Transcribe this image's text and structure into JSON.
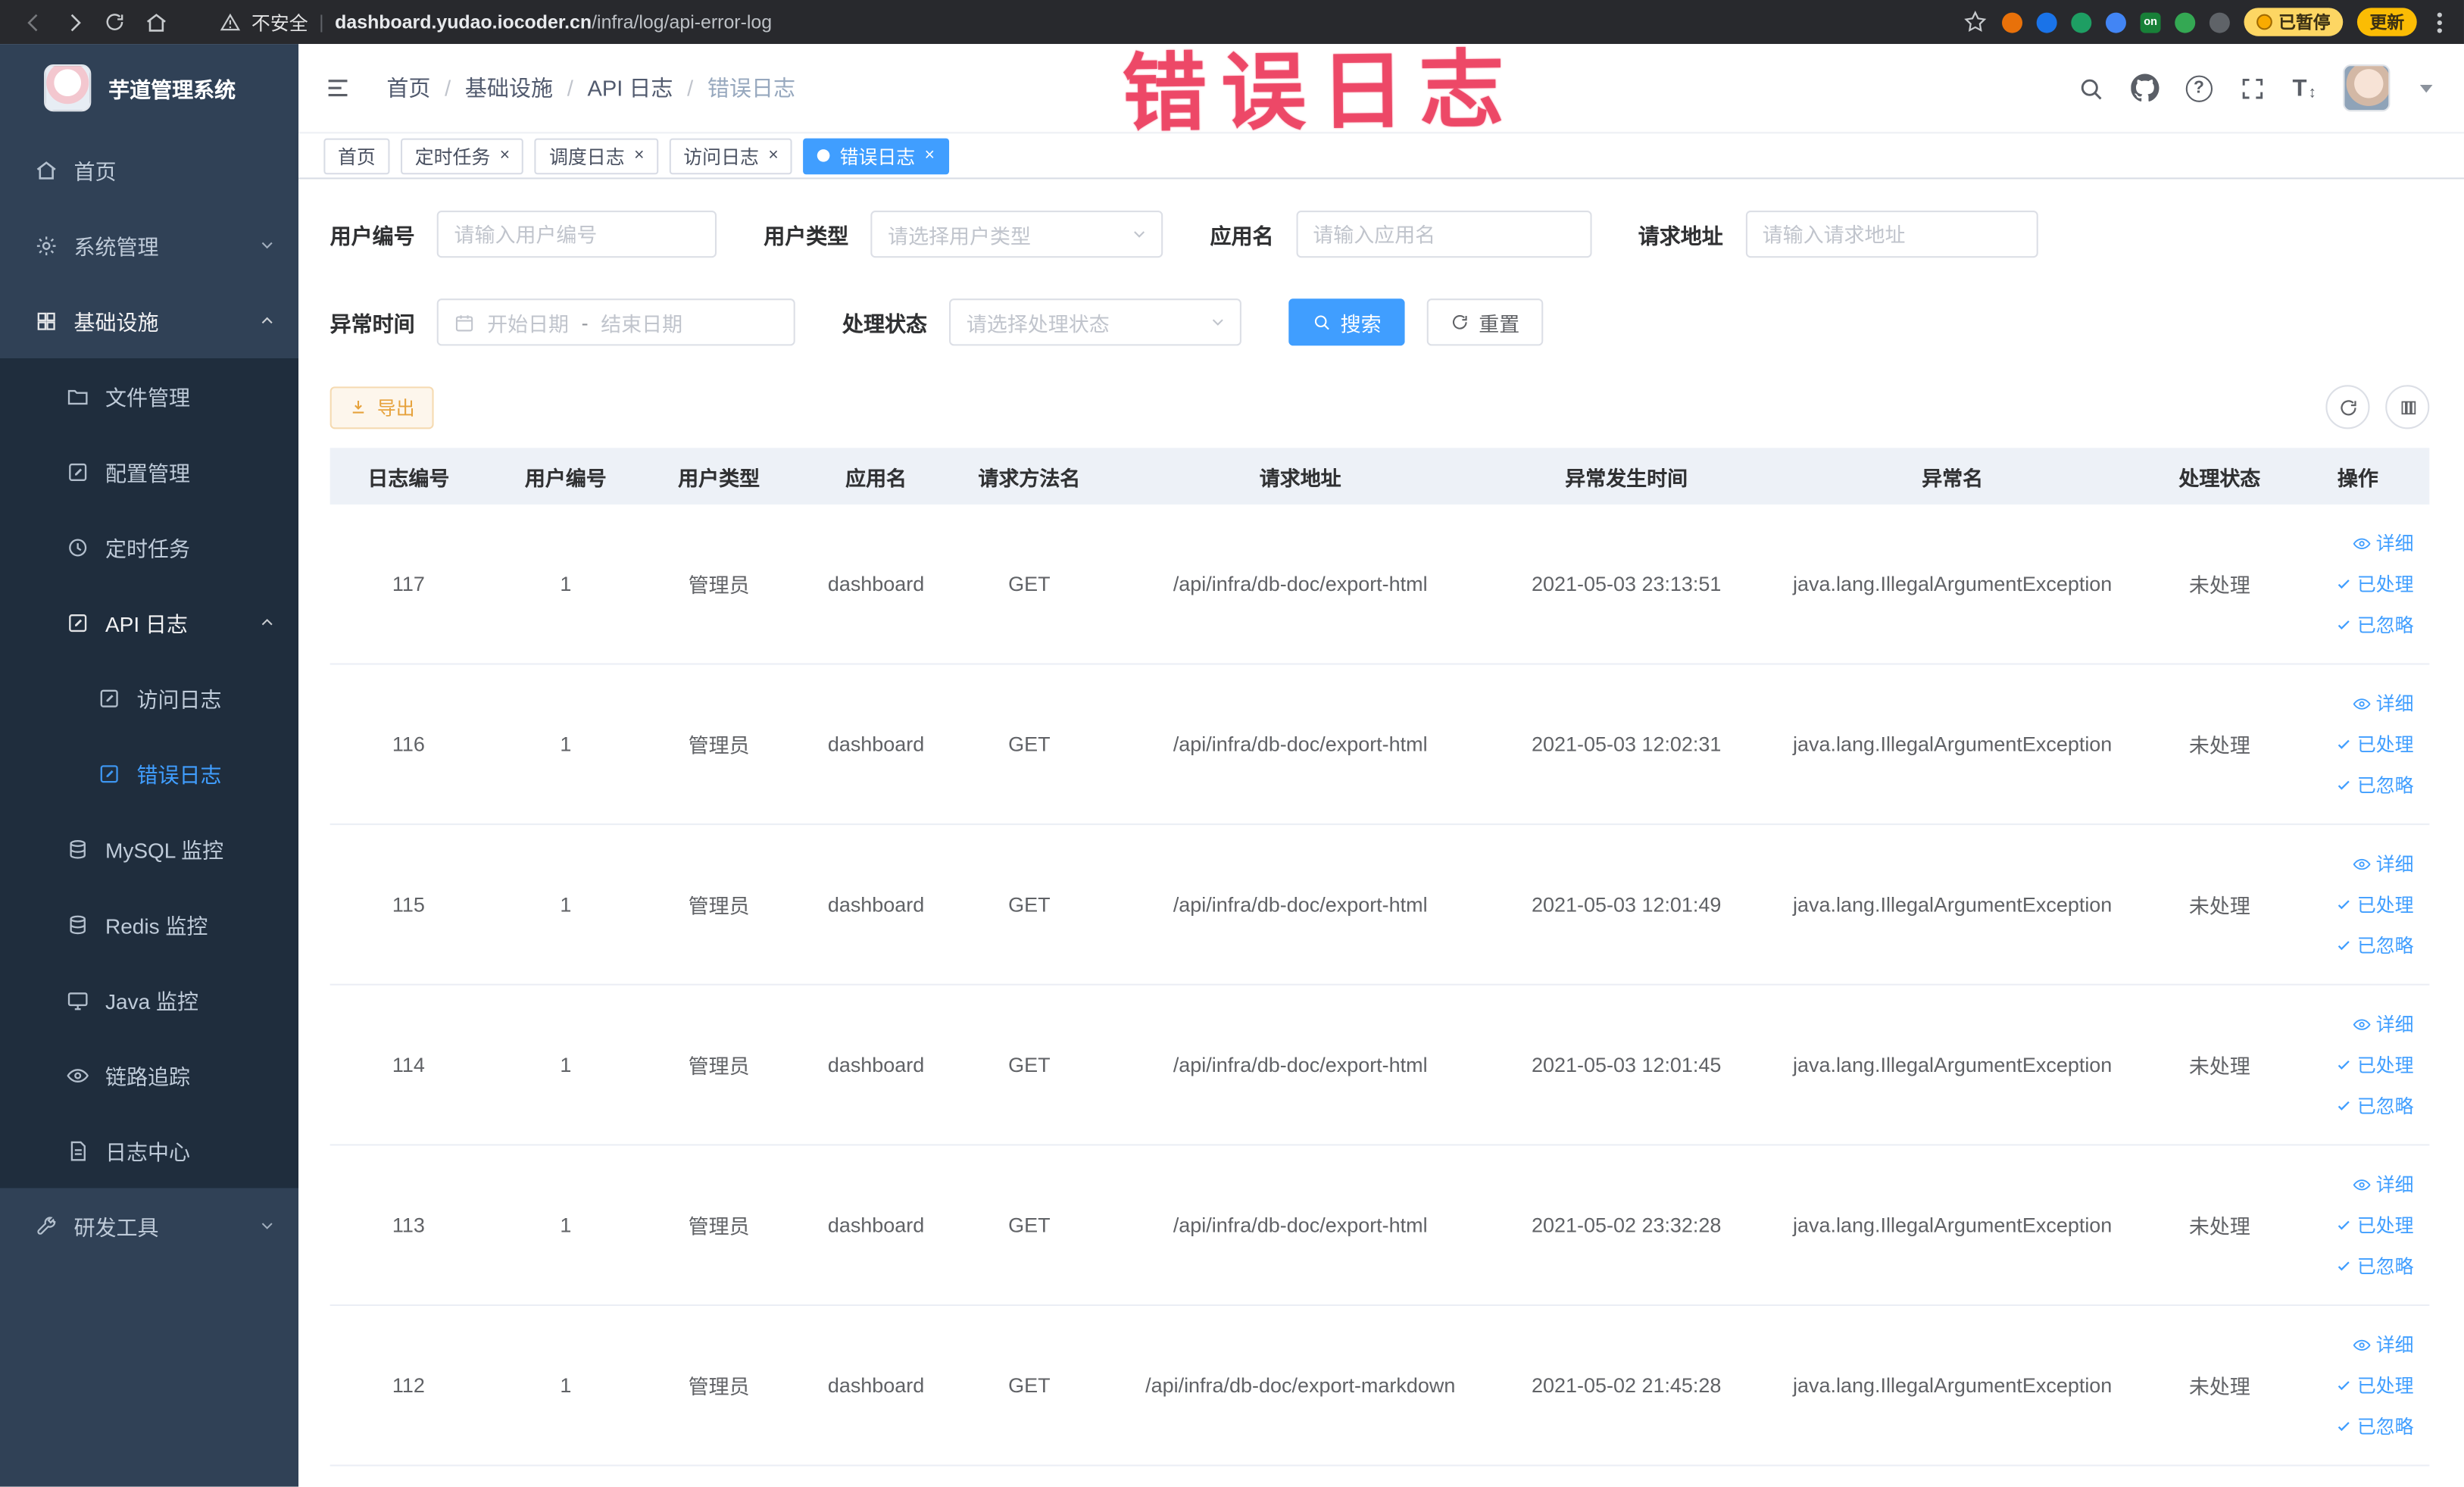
{
  "colors": {
    "accent": "#409eff",
    "warning": "#e6a23c",
    "annotation": "#ec3e5e",
    "sidebar_bg": "#304156",
    "submenu_bg": "#1f2d3d"
  },
  "ui": {
    "close_glyph": "×",
    "help_glyph": "?",
    "font_size_glyph": "T",
    "font_size_arrows": "↕",
    "url_divider": "|",
    "breadcrumb_sep": "/",
    "ext_on_label": "on"
  },
  "browser": {
    "security_text": "不安全",
    "url_host": "dashboard.yudao.iocoder.cn",
    "url_path": "/infra/log/api-error-log",
    "paused_badge": "已暂停",
    "update_label": "更新"
  },
  "annotation": {
    "text": "错误日志"
  },
  "sidebar": {
    "app_title": "芋道管理系统",
    "items": [
      {
        "label": "首页"
      },
      {
        "label": "系统管理"
      },
      {
        "label": "基础设施"
      },
      {
        "label": "文件管理"
      },
      {
        "label": "配置管理"
      },
      {
        "label": "定时任务"
      },
      {
        "label": "API 日志"
      },
      {
        "label": "访问日志"
      },
      {
        "label": "错误日志"
      },
      {
        "label": "MySQL 监控"
      },
      {
        "label": "Redis 监控"
      },
      {
        "label": "Java 监控"
      },
      {
        "label": "链路追踪"
      },
      {
        "label": "日志中心"
      },
      {
        "label": "研发工具"
      }
    ]
  },
  "header": {
    "breadcrumb": [
      "首页",
      "基础设施",
      "API 日志",
      "错误日志"
    ]
  },
  "tabs": {
    "items": [
      "首页",
      "定时任务",
      "调度日志",
      "访问日志",
      "错误日志"
    ],
    "active_index": 4
  },
  "filters": {
    "user_id": {
      "label": "用户编号",
      "placeholder": "请输入用户编号"
    },
    "user_type": {
      "label": "用户类型",
      "placeholder": "请选择用户类型"
    },
    "app_name": {
      "label": "应用名",
      "placeholder": "请输入应用名"
    },
    "request_url": {
      "label": "请求地址",
      "placeholder": "请输入请求地址"
    },
    "exception_time": {
      "label": "异常时间",
      "start_placeholder": "开始日期",
      "separator": "-",
      "end_placeholder": "结束日期"
    },
    "process_status": {
      "label": "处理状态",
      "placeholder": "请选择处理状态"
    },
    "search_label": "搜索",
    "reset_label": "重置"
  },
  "toolbar": {
    "export_label": "导出"
  },
  "table": {
    "columns": [
      "日志编号",
      "用户编号",
      "用户类型",
      "应用名",
      "请求方法名",
      "请求地址",
      "异常发生时间",
      "异常名",
      "处理状态",
      "操作"
    ],
    "actions": {
      "detail": "详细",
      "processed": "已处理",
      "ignored": "已忽略"
    },
    "rows": [
      {
        "id": "117",
        "user_id": "1",
        "user_type": "管理员",
        "app": "dashboard",
        "method": "GET",
        "url": "/api/infra/db-doc/export-html",
        "time": "2021-05-03 23:13:51",
        "exception": "java.lang.IllegalArgumentException",
        "status": "未处理"
      },
      {
        "id": "116",
        "user_id": "1",
        "user_type": "管理员",
        "app": "dashboard",
        "method": "GET",
        "url": "/api/infra/db-doc/export-html",
        "time": "2021-05-03 12:02:31",
        "exception": "java.lang.IllegalArgumentException",
        "status": "未处理"
      },
      {
        "id": "115",
        "user_id": "1",
        "user_type": "管理员",
        "app": "dashboard",
        "method": "GET",
        "url": "/api/infra/db-doc/export-html",
        "time": "2021-05-03 12:01:49",
        "exception": "java.lang.IllegalArgumentException",
        "status": "未处理"
      },
      {
        "id": "114",
        "user_id": "1",
        "user_type": "管理员",
        "app": "dashboard",
        "method": "GET",
        "url": "/api/infra/db-doc/export-html",
        "time": "2021-05-03 12:01:45",
        "exception": "java.lang.IllegalArgumentException",
        "status": "未处理"
      },
      {
        "id": "113",
        "user_id": "1",
        "user_type": "管理员",
        "app": "dashboard",
        "method": "GET",
        "url": "/api/infra/db-doc/export-html",
        "time": "2021-05-02 23:32:28",
        "exception": "java.lang.IllegalArgumentException",
        "status": "未处理"
      },
      {
        "id": "112",
        "user_id": "1",
        "user_type": "管理员",
        "app": "dashboard",
        "method": "GET",
        "url": "/api/infra/db-doc/export-markdown",
        "time": "2021-05-02 21:45:28",
        "exception": "java.lang.IllegalArgumentException",
        "status": "未处理"
      }
    ]
  }
}
